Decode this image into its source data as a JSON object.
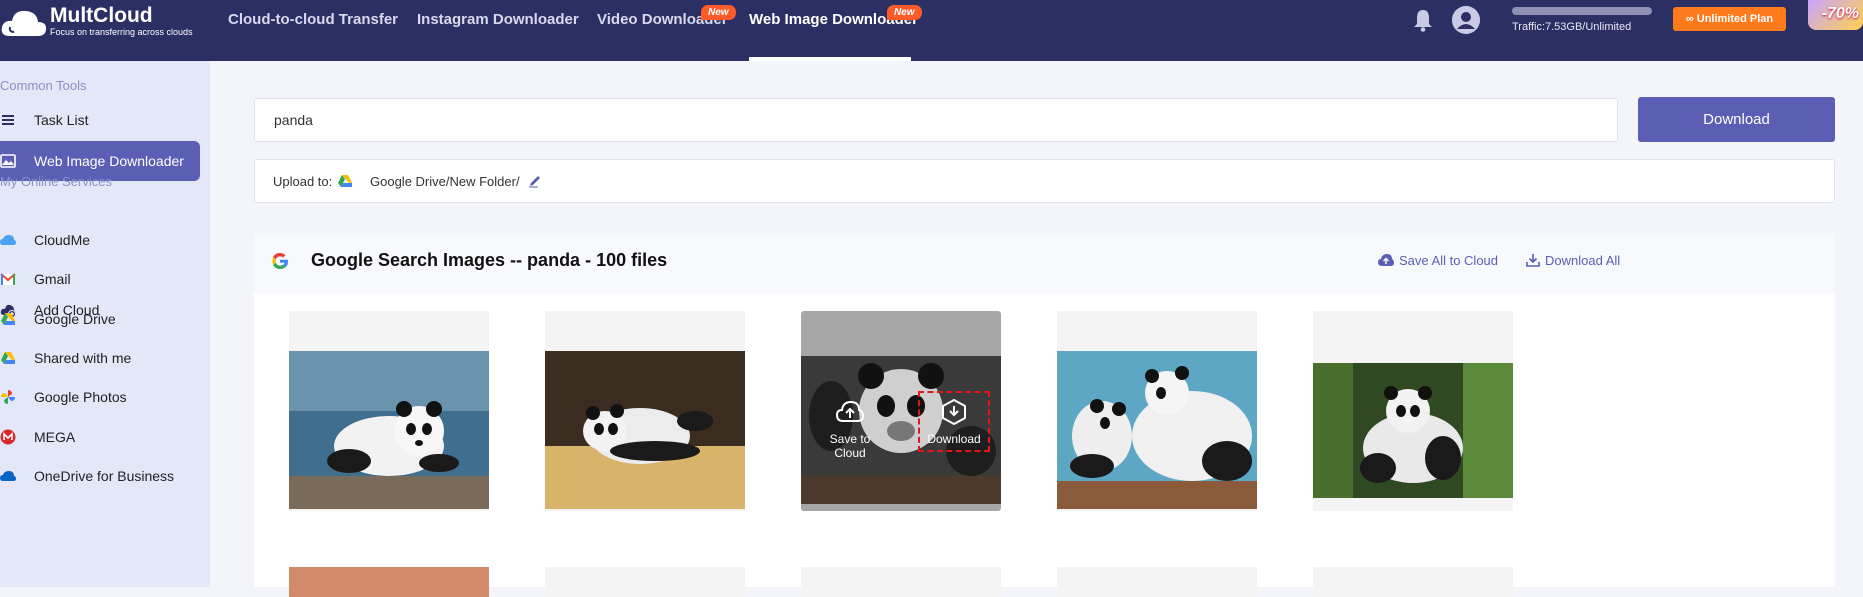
{
  "app": {
    "name": "MultCloud",
    "tagline": "Focus on transferring across clouds"
  },
  "nav": {
    "items": [
      {
        "label": "Cloud-to-cloud Transfer"
      },
      {
        "label": "Instagram Downloader"
      },
      {
        "label": "Video Downloader",
        "badge": "New"
      },
      {
        "label": "Web Image Downloader",
        "badge": "New",
        "active": true
      }
    ]
  },
  "account": {
    "traffic": "Traffic:7.53GB/Unlimited",
    "plan_button": "Unlimited Plan",
    "promo": "-70%"
  },
  "sidebar": {
    "common_tools_heading": "Common Tools",
    "tools": [
      {
        "label": "Task List"
      },
      {
        "label": "Web Image Downloader",
        "active": true
      }
    ],
    "services_heading": "My Online Services",
    "services": [
      {
        "label": "Add Cloud"
      },
      {
        "label": "CloudMe"
      },
      {
        "label": "Gmail"
      },
      {
        "label": "Google Drive"
      },
      {
        "label": "Shared with me"
      },
      {
        "label": "Google Photos"
      },
      {
        "label": "MEGA"
      },
      {
        "label": "OneDrive for Business"
      }
    ]
  },
  "search": {
    "value": "panda",
    "button": "Download"
  },
  "upload": {
    "label": "Upload to:",
    "path": "Google Drive/New Folder/"
  },
  "results": {
    "title": "Google Search Images -- panda - 100 files",
    "save_all": "Save All to Cloud",
    "download_all": "Download All",
    "hover_actions": {
      "save": "Save to Cloud",
      "download": "Download"
    }
  },
  "colors": {
    "topbar": "#2c2f63",
    "accent": "#5a5fb5",
    "sidebar": "#e4e7f8",
    "orange": "#ff7a1a"
  }
}
